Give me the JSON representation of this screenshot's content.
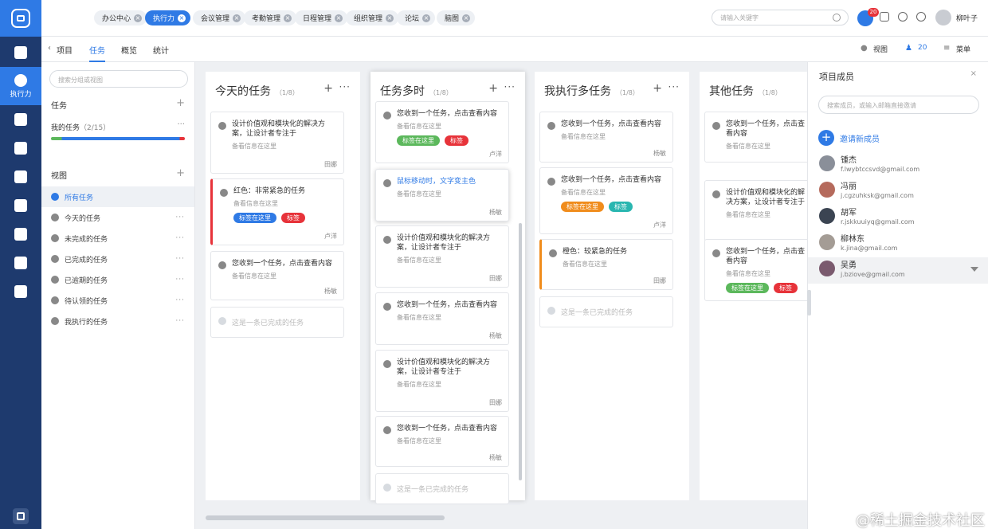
{
  "app": {
    "nav_active_label": "执行力"
  },
  "top_tabs": [
    {
      "label": "办公中心",
      "x": 66
    },
    {
      "label": "执行力",
      "active": true
    },
    {
      "label": "会议管理"
    },
    {
      "label": "考勤管理"
    },
    {
      "label": "日程管理"
    },
    {
      "label": "组织管理"
    },
    {
      "label": "论坛"
    },
    {
      "label": "脑图"
    }
  ],
  "search": {
    "placeholder": "请输入关键字"
  },
  "msg_count": "20",
  "user": {
    "name": "柳叶子"
  },
  "subbar": {
    "back": "项目",
    "tabs": [
      "任务",
      "概览",
      "统计"
    ],
    "view": "视图",
    "members": "20",
    "menu": "菜单"
  },
  "sidebar": {
    "search_placeholder": "搜索分组或视图",
    "task_header": "任务",
    "my_tasks": "我的任务",
    "my_tasks_count": "（2/15）",
    "view_header": "视图",
    "views": [
      "所有任务",
      "今天的任务",
      "未完成的任务",
      "已完成的任务",
      "已逾期的任务",
      "待认领的任务",
      "我执行的任务"
    ]
  },
  "columns": [
    {
      "title": "今天的任务",
      "count": "（1/8）",
      "cards": [
        {
          "text": "设计价值观和模块化的解决方案，让设计者专注于",
          "note": "备看信息在这里",
          "user": "田娜"
        },
        {
          "text": "红色：非常紧急的任务",
          "note": "备看信息在这里",
          "tags": [
            "标签在这里",
            "标签"
          ],
          "user": "卢洋",
          "accent": "#e7333a"
        },
        {
          "text": "您收到一个任务，点击查看内容",
          "note": "备看信息在这里",
          "user": "杨敏"
        }
      ],
      "done": "这是一条已完成的任务"
    },
    {
      "title": "任务多时",
      "count": "（1/8）",
      "cards": [
        {
          "text": "您收到一个任务，点击查看内容",
          "note": "备看信息在这里",
          "tags": [
            "标签在这里",
            "标签"
          ],
          "user": "卢洋"
        },
        {
          "text": "鼠标移动时，文字变主色",
          "note": "备看信息在这里",
          "user": "杨敏",
          "hover": true
        },
        {
          "text": "设计价值观和模块化的解决方案，让设计者专注于",
          "note": "备看信息在这里",
          "user": "田娜"
        },
        {
          "text": "您收到一个任务，点击查看内容",
          "note": "备看信息在这里",
          "user": "杨敏"
        },
        {
          "text": "设计价值观和模块化的解决方案，让设计者专注于",
          "note": "备看信息在这里",
          "user": "田娜"
        },
        {
          "text": "您收到一个任务，点击查看内容",
          "note": "备看信息在这里",
          "user": "杨敏"
        }
      ],
      "done": "这是一条已完成的任务"
    },
    {
      "title": "我执行多任务",
      "count": "（1/8）",
      "cards": [
        {
          "text": "您收到一个任务，点击查看内容",
          "note": "备看信息在这里",
          "user": "杨敏"
        },
        {
          "text": "您收到一个任务，点击查看内容",
          "note": "备看信息在这里",
          "tags": [
            "标签在这里",
            "标签"
          ],
          "user": "卢洋"
        },
        {
          "text": "橙色：较紧急的任务",
          "note": "备看信息在这里",
          "user": "田娜",
          "accent": "#f08c1c"
        }
      ],
      "done": "这是一条已完成的任务"
    },
    {
      "title": "其他任务",
      "count": "（1/8）",
      "cards": [
        {
          "text": "您收到一个任务，点击查看内容",
          "note": "备看信息在这里",
          "user": ""
        },
        {
          "text": "设计价值观和模块化的解决方案，让设计者专注于",
          "note": "备看信息在这里",
          "user": ""
        },
        {
          "text": "您收到一个任务，点击查看内容",
          "note": "备看信息在这里",
          "tags": [
            "标签在这里",
            "标签"
          ],
          "user": ""
        }
      ]
    }
  ],
  "panel": {
    "title": "项目成员",
    "search_placeholder": "搜索成员，或输入邮箱直接邀请",
    "invite": "邀请新成员",
    "members": [
      {
        "name": "锺杰",
        "email": "f.lwybtccsvd@gmail.com"
      },
      {
        "name": "冯丽",
        "email": "j.cgzuhksk@gmail.com"
      },
      {
        "name": "胡军",
        "email": "r.jskkuuiyq@gmail.com"
      },
      {
        "name": "柳林东",
        "email": "k.jina@gmail.com"
      },
      {
        "name": "吴勇",
        "email": "j.bziove@gmail.com"
      }
    ]
  },
  "watermark": "@稀土掘金技术社区",
  "colors": {
    "primary": "#2f7ae5",
    "nav": "#1e3a6e",
    "red": "#e7333a",
    "orange": "#f08c1c",
    "green": "#5cb85c",
    "teal": "#29b6b0"
  }
}
